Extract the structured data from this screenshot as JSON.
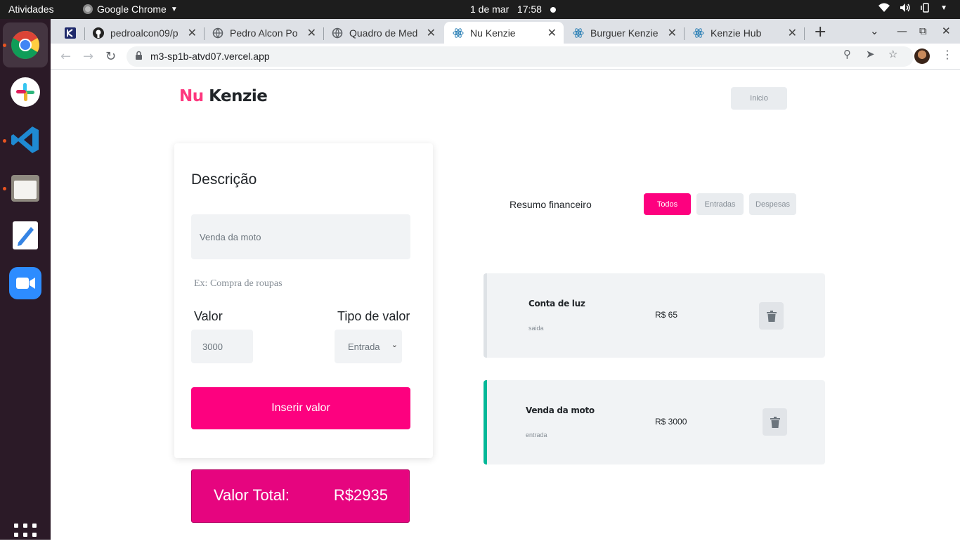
{
  "system": {
    "activities": "Atividades",
    "app_name": "Google Chrome",
    "date": "1 de mar",
    "time": "17:58"
  },
  "browser": {
    "tabs": [
      {
        "label": "pedroalcon09/p",
        "icon": "github-icon"
      },
      {
        "label": "Pedro Alcon Po",
        "icon": "globe-icon"
      },
      {
        "label": "Quadro de Med",
        "icon": "globe-icon"
      },
      {
        "label": "Nu Kenzie",
        "icon": "react-icon",
        "active": true
      },
      {
        "label": "Burguer Kenzie",
        "icon": "react-icon"
      },
      {
        "label": "Kenzie Hub",
        "icon": "react-icon"
      }
    ],
    "url": "m3-sp1b-atvd07.vercel.app"
  },
  "header": {
    "logo_nu": "Nu",
    "logo_kenzie": "Kenzie",
    "inicio_label": "Inicio"
  },
  "form": {
    "title": "Descrição",
    "description_value": "Venda da moto",
    "hint": "Ex: Compra de roupas",
    "valor_label": "Valor",
    "valor_value": "3000",
    "tipo_label": "Tipo de valor",
    "tipo_selected": "Entrada",
    "submit_label": "Inserir valor"
  },
  "total": {
    "label": "Valor Total:",
    "value": "R$2935"
  },
  "summary": {
    "title": "Resumo financeiro",
    "filters": [
      "Todos",
      "Entradas",
      "Despesas"
    ],
    "active_filter": "Todos"
  },
  "entries": [
    {
      "title": "Conta de luz",
      "type": "saida",
      "value": "R$ 65",
      "accent": "#dee2e6"
    },
    {
      "title": "Venda da moto",
      "type": "entrada",
      "value": "R$ 3000",
      "accent": "#03b898"
    }
  ],
  "colors": {
    "primary": "#fd017f",
    "income": "#03b898",
    "expense": "#dee2e6"
  }
}
